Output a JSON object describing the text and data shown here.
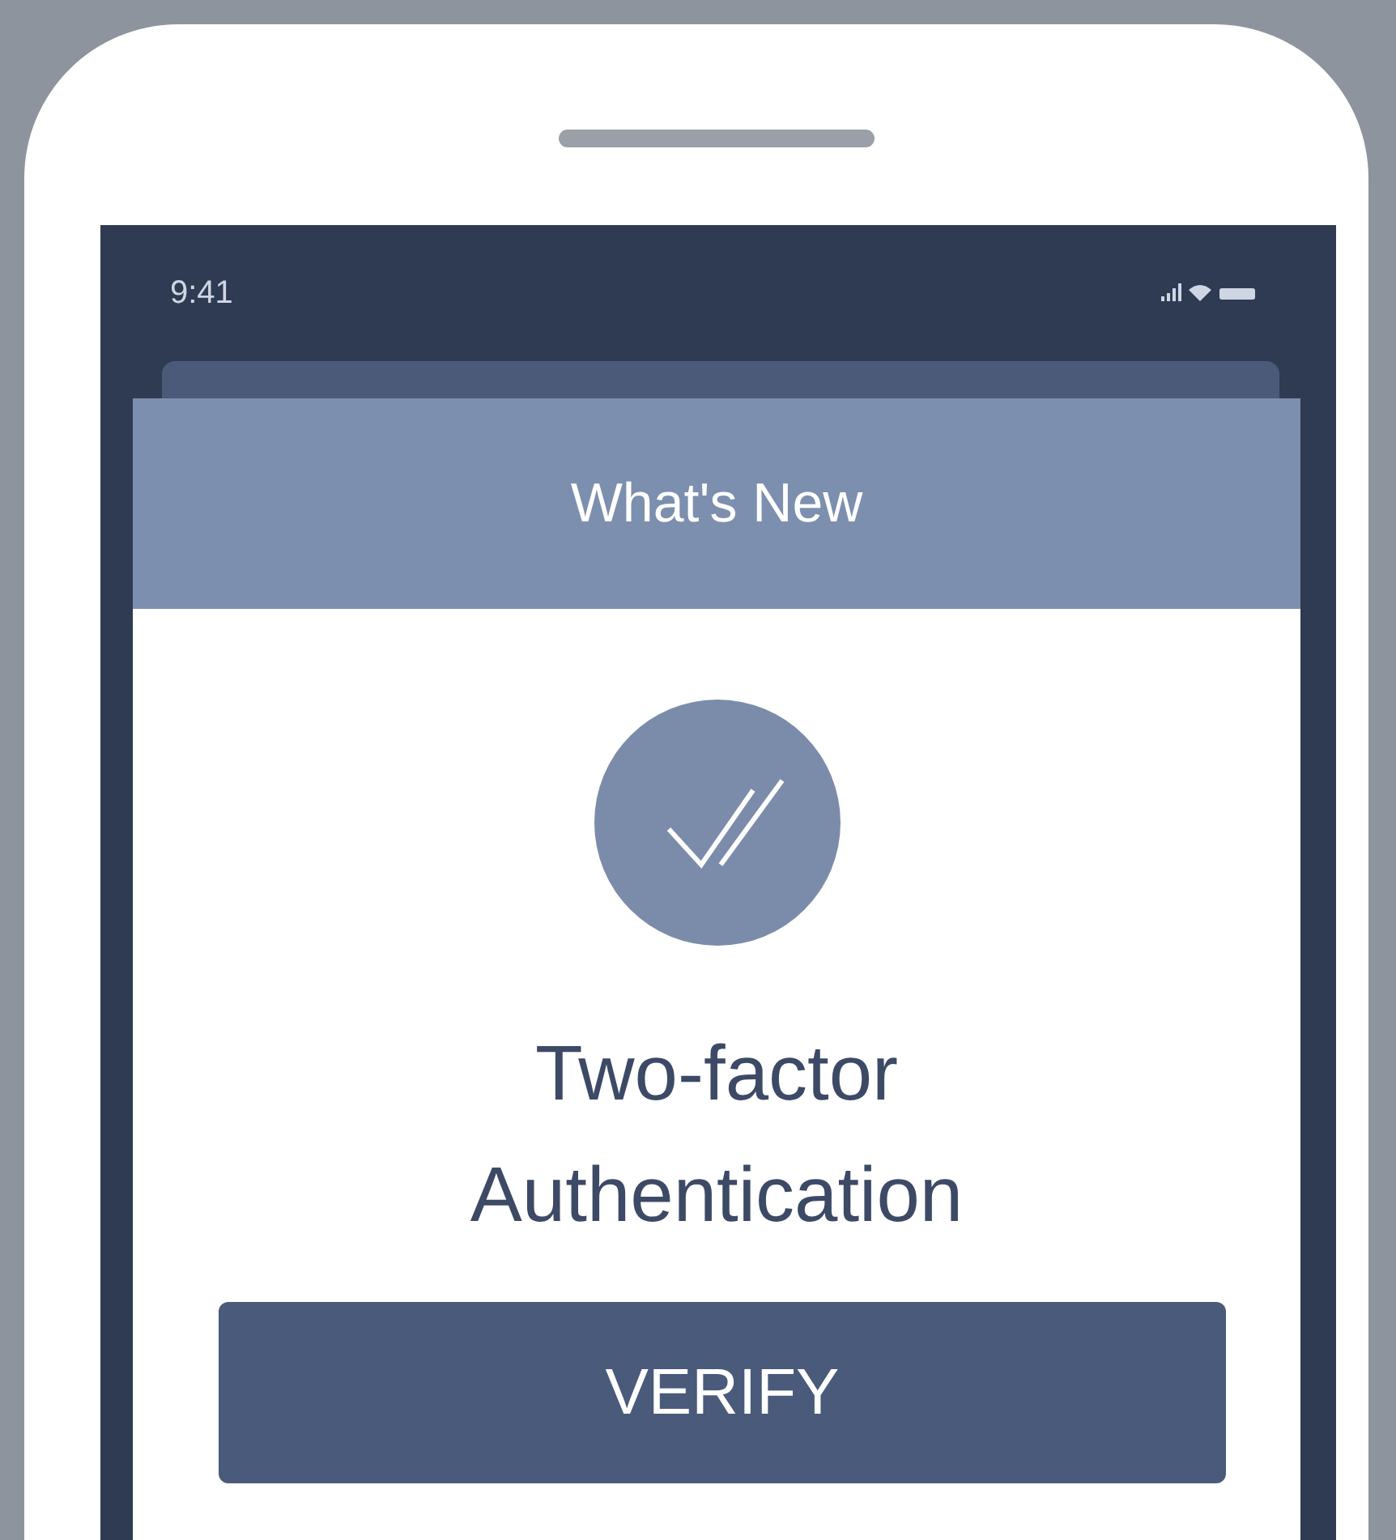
{
  "status_bar": {
    "time": "9:41"
  },
  "dialog": {
    "header": "What's New",
    "title": "Two-factor Authentication",
    "button": "VERIFY"
  }
}
